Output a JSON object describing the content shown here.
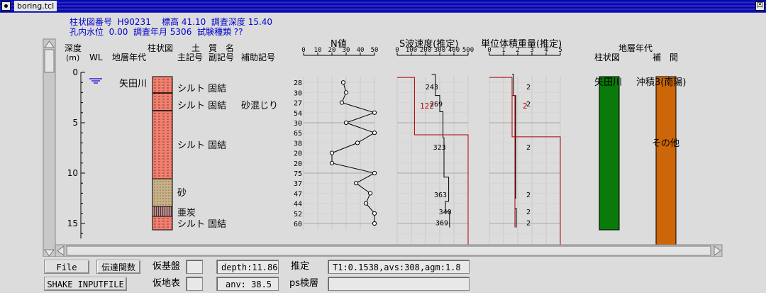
{
  "window": {
    "title": "boring.tcl",
    "right_icon": "凹"
  },
  "header": {
    "line1": "柱状図番号  H90231    標高 41.10  調査深度 15.40",
    "line2": "孔内水位  0.00  調査年月 5306  試験種類 ??"
  },
  "columns": {
    "depth": "深度",
    "depth_unit": "(m)",
    "wl": "WL",
    "age": "地層年代",
    "column": "柱状図",
    "soil": "土　質　名",
    "main_code": "主記号",
    "sub_code": "副記号",
    "aux_code": "補助記号",
    "n_title": "N値",
    "vs_title": "S波速度(推定)",
    "density_title": "単位体積重量(推定)",
    "right_title": "地層年代",
    "right_col1": "柱状図",
    "right_col2": "補　間"
  },
  "depth_ticks": [
    "0",
    "5",
    "10",
    "15"
  ],
  "age_label": "矢田川",
  "soil_labels": [
    "シルト 固結",
    "シルト 固結",
    "砂混じり",
    "シルト 固結",
    "砂",
    "亜炭",
    "シルト 固結"
  ],
  "chart_data": [
    {
      "type": "line",
      "title": "N値",
      "xlim": [
        0,
        50
      ],
      "xticks": [
        "0",
        "10",
        "20",
        "30",
        "40",
        "50"
      ],
      "ylabel": "深度 (m)",
      "y": [
        1,
        2,
        3,
        4,
        5,
        6,
        7,
        8,
        9,
        10,
        11,
        12,
        13,
        14,
        15
      ],
      "values": [
        28,
        30,
        27,
        54,
        30,
        65,
        38,
        20,
        20,
        75,
        37,
        47,
        44,
        52,
        60
      ],
      "labels": [
        "28",
        "30",
        "27",
        "54",
        "30",
        "65",
        "38",
        "20",
        "20",
        "75",
        "37",
        "47",
        "44",
        "52",
        "60"
      ],
      "plot_values": [
        28,
        30,
        27,
        50,
        30,
        50,
        38,
        20,
        20,
        50,
        37,
        47,
        44,
        50,
        50
      ]
    },
    {
      "type": "line",
      "title": "S波速度(推定)",
      "xlim": [
        0,
        500
      ],
      "xticks": [
        "0",
        "100",
        "200",
        "300",
        "400",
        "500"
      ],
      "profile": [
        [
          0.2,
          243
        ],
        [
          2.3,
          269
        ],
        [
          3.9,
          300
        ],
        [
          6.5,
          323
        ],
        [
          10.4,
          330
        ],
        [
          12.8,
          363
        ],
        [
          13.8,
          340
        ],
        [
          14.6,
          369
        ],
        [
          15.4,
          369
        ]
      ],
      "labels": [
        "243",
        "269",
        "323",
        "363",
        "340",
        "369"
      ],
      "label_depths": [
        1.4,
        3.1,
        7.4,
        12.1,
        13.8,
        14.9
      ],
      "secondary_label": "122",
      "secondary_label_depth": 3.3,
      "secondary_profile": [
        [
          0.5,
          122
        ],
        [
          6.2,
          122
        ],
        [
          6.2,
          500
        ],
        [
          15.4,
          500
        ]
      ]
    },
    {
      "type": "line",
      "title": "単位体積重量(推定)",
      "xlim": [
        0,
        5
      ],
      "xticks": [
        "0",
        "1",
        "2",
        "3",
        "4",
        "5"
      ],
      "profile": [
        [
          0.2,
          1.6
        ],
        [
          2.3,
          1.7
        ],
        [
          6.4,
          1.85
        ],
        [
          10.4,
          1.85
        ],
        [
          12.5,
          1.85
        ],
        [
          13.5,
          1.8
        ],
        [
          14.2,
          1.9
        ],
        [
          15.4,
          1.9
        ]
      ],
      "labels": [
        "2",
        "2",
        "2",
        "2",
        "2",
        "2"
      ],
      "label_depths": [
        1.4,
        3.1,
        7.4,
        12.1,
        13.8,
        14.9
      ],
      "secondary_label": "2",
      "secondary_label_depth": 3.3
    }
  ],
  "right_panel": {
    "col1_label": "矢田川",
    "col2_label": "沖積3(南陽)",
    "col2_mid_label": "その他",
    "col1_color": "#0a7a0a",
    "col2_color": "#cc6608"
  },
  "colors": {
    "silt": "#f08070",
    "sand": "#c8b088",
    "lignite": "#b07070",
    "blue_text": "#0000d0",
    "vs_red": "#c00000"
  },
  "bottom": {
    "file_button": "File",
    "transfer_button": "伝達関数",
    "base_label": "仮基盤",
    "surface_label": "仮地表",
    "shake_button": "SHAKE INPUTFILE",
    "depth_field": "depth:11.86",
    "anv_field": "anv: 38.5",
    "estimate_label": "推定",
    "estimate_field": "T1:0.1538,avs:308,agm:1.8",
    "ps_label": "ps検層"
  }
}
